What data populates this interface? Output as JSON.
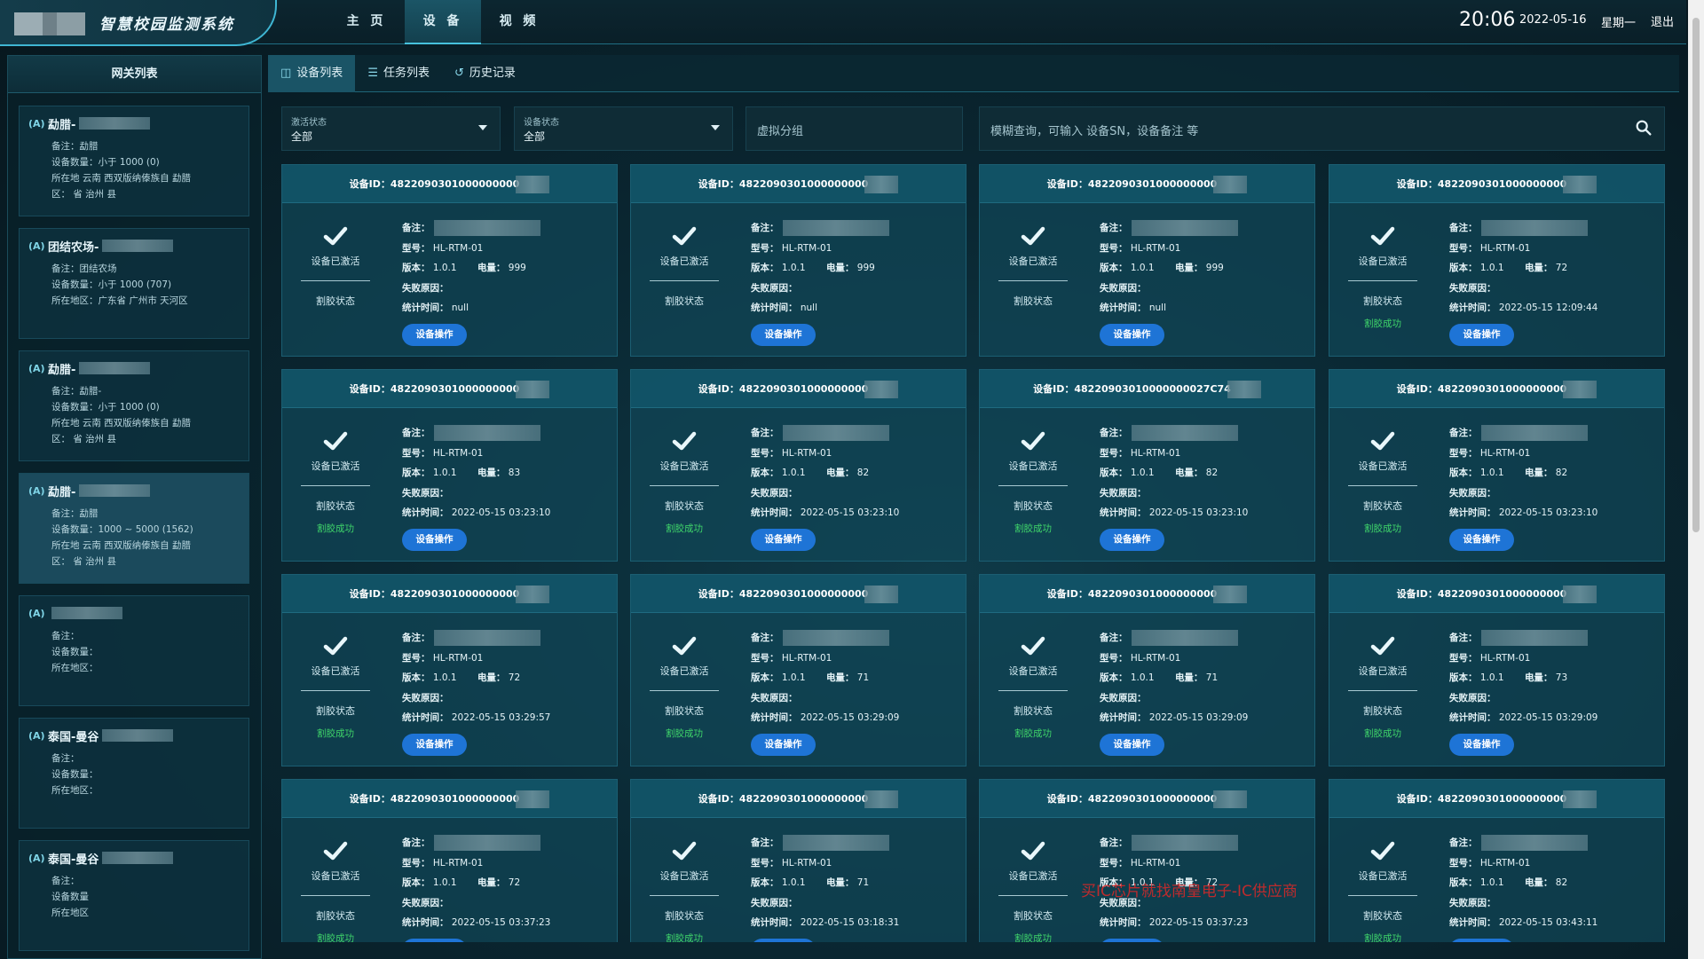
{
  "header": {
    "app_title": "智慧校园监测系统",
    "nav": [
      "主 页",
      "设 备",
      "视 频"
    ],
    "active_nav": 1,
    "time": "20:06",
    "date": "2022-05-16",
    "weekday": "星期一",
    "logout": "退出"
  },
  "left_panel": {
    "title": "网关列表",
    "gateways": [
      {
        "name": "勐腊-",
        "lines": [
          "备注：勐腊",
          "设备数量：小于 1000  (0)",
          "所在地    云南    西双版纳傣族自    勐腊",
          "区：       省        治州                县"
        ],
        "active": false
      },
      {
        "name": "团结农场-",
        "lines": [
          "备注：团结农场",
          "设备数量：小于 1000  (707)",
          "所在地区：广东省 广州市 天河区"
        ],
        "active": false
      },
      {
        "name": "勐腊-",
        "lines": [
          "备注：勐腊-",
          "设备数量：小于 1000  (0)",
          "所在地    云南    西双版纳傣族自    勐腊",
          "区：       省        治州                县"
        ],
        "active": false
      },
      {
        "name": "勐腊-",
        "lines": [
          "备注：勐腊",
          "设备数量：1000 ~ 5000  (1562)",
          "所在地    云南    西双版纳傣族自    勐腊",
          "区：       省        治州                县"
        ],
        "active": true
      },
      {
        "name": "",
        "lines": [
          "备注：",
          "设备数量：",
          "所在地区："
        ],
        "active": false
      },
      {
        "name": "泰国-曼谷",
        "lines": [
          "备注：",
          "设备数量：",
          "所在地区："
        ],
        "active": false
      },
      {
        "name": "泰国-曼谷",
        "lines": [
          "备注：",
          "设备数量",
          "所在地区"
        ],
        "active": false
      }
    ]
  },
  "tabs": [
    {
      "label": "设备列表",
      "icon": "database-icon"
    },
    {
      "label": "任务列表",
      "icon": "list-icon"
    },
    {
      "label": "历史记录",
      "icon": "history-icon"
    }
  ],
  "filters": {
    "activation": {
      "caption": "激活状态",
      "value": "全部"
    },
    "device_status": {
      "caption": "设备状态",
      "value": "全部"
    },
    "virtual_group_placeholder": "虚拟分组",
    "search_placeholder": "模糊查询，可输入 设备SN，设备备注 等"
  },
  "labels": {
    "device_id": "设备ID：",
    "remark": "备注：",
    "model": "型号：",
    "version": "版本：",
    "battery": "电量：",
    "fail_reason": "失败原因：",
    "stat_time": "统计时间：",
    "activated": "设备已激活",
    "cut_state": "割胶状态",
    "cut_success": "割胶成功",
    "op_button": "设备操作"
  },
  "devices": [
    {
      "id": "4822090301000000000",
      "model": "HL-RTM-01",
      "version": "1.0.1",
      "battery": "999",
      "fail": "",
      "time": "null",
      "cut_success": false
    },
    {
      "id": "4822090301000000000",
      "model": "HL-RTM-01",
      "version": "1.0.1",
      "battery": "999",
      "fail": "",
      "time": "null",
      "cut_success": false
    },
    {
      "id": "4822090301000000000",
      "model": "HL-RTM-01",
      "version": "1.0.1",
      "battery": "999",
      "fail": "",
      "time": "null",
      "cut_success": false
    },
    {
      "id": "4822090301000000000",
      "model": "HL-RTM-01",
      "version": "1.0.1",
      "battery": "72",
      "fail": "",
      "time": "2022-05-15 12:09:44",
      "cut_success": true
    },
    {
      "id": "4822090301000000000",
      "model": "HL-RTM-01",
      "version": "1.0.1",
      "battery": "83",
      "fail": "",
      "time": "2022-05-15 03:23:10",
      "cut_success": true
    },
    {
      "id": "4822090301000000000",
      "model": "HL-RTM-01",
      "version": "1.0.1",
      "battery": "82",
      "fail": "",
      "time": "2022-05-15 03:23:10",
      "cut_success": true
    },
    {
      "id": "48220903010000000027C74",
      "model": "HL-RTM-01",
      "version": "1.0.1",
      "battery": "82",
      "fail": "",
      "time": "2022-05-15 03:23:10",
      "cut_success": true
    },
    {
      "id": "4822090301000000000",
      "model": "HL-RTM-01",
      "version": "1.0.1",
      "battery": "82",
      "fail": "",
      "time": "2022-05-15 03:23:10",
      "cut_success": true
    },
    {
      "id": "4822090301000000000",
      "model": "HL-RTM-01",
      "version": "1.0.1",
      "battery": "72",
      "fail": "",
      "time": "2022-05-15 03:29:57",
      "cut_success": true
    },
    {
      "id": "4822090301000000000",
      "model": "HL-RTM-01",
      "version": "1.0.1",
      "battery": "71",
      "fail": "",
      "time": "2022-05-15 03:29:09",
      "cut_success": true
    },
    {
      "id": "4822090301000000000",
      "model": "HL-RTM-01",
      "version": "1.0.1",
      "battery": "71",
      "fail": "",
      "time": "2022-05-15 03:29:09",
      "cut_success": true
    },
    {
      "id": "4822090301000000000",
      "model": "HL-RTM-01",
      "version": "1.0.1",
      "battery": "73",
      "fail": "",
      "time": "2022-05-15 03:29:09",
      "cut_success": true
    },
    {
      "id": "4822090301000000000",
      "model": "HL-RTM-01",
      "version": "1.0.1",
      "battery": "72",
      "fail": "",
      "time": "2022-05-15 03:37:23",
      "cut_success": true
    },
    {
      "id": "4822090301000000000",
      "model": "HL-RTM-01",
      "version": "1.0.1",
      "battery": "71",
      "fail": "",
      "time": "2022-05-15 03:18:31",
      "cut_success": true
    },
    {
      "id": "4822090301000000000",
      "model": "HL-RTM-01",
      "version": "1.0.1",
      "battery": "72",
      "fail": "",
      "time": "2022-05-15 03:37:23",
      "cut_success": true
    },
    {
      "id": "4822090301000000000",
      "model": "HL-RTM-01",
      "version": "1.0.1",
      "battery": "82",
      "fail": "",
      "time": "2022-05-15 03:43:11",
      "cut_success": true
    }
  ],
  "watermark": "买IC芯片就找南皇电子-IC供应商",
  "colors": {
    "accent": "#47c2dd",
    "success": "#3fd56a",
    "button": "#1e74d6",
    "watermark": "#dc2828"
  }
}
